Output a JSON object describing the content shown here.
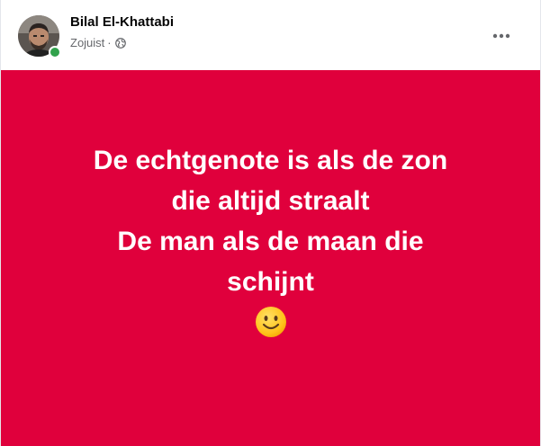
{
  "post": {
    "author": "Bilal El-Khattabi",
    "timestamp": "Zojuist",
    "separator": "·",
    "privacy_icon": "globe-icon",
    "more_icon": "more-options-icon",
    "online": true,
    "background_color": "#e0003c",
    "text_lines": [
      "De echtgenote is als de zon",
      "die altijd straalt",
      "De man als de maan die",
      "schijnt"
    ],
    "emoji": "slightly-smiling-face"
  }
}
